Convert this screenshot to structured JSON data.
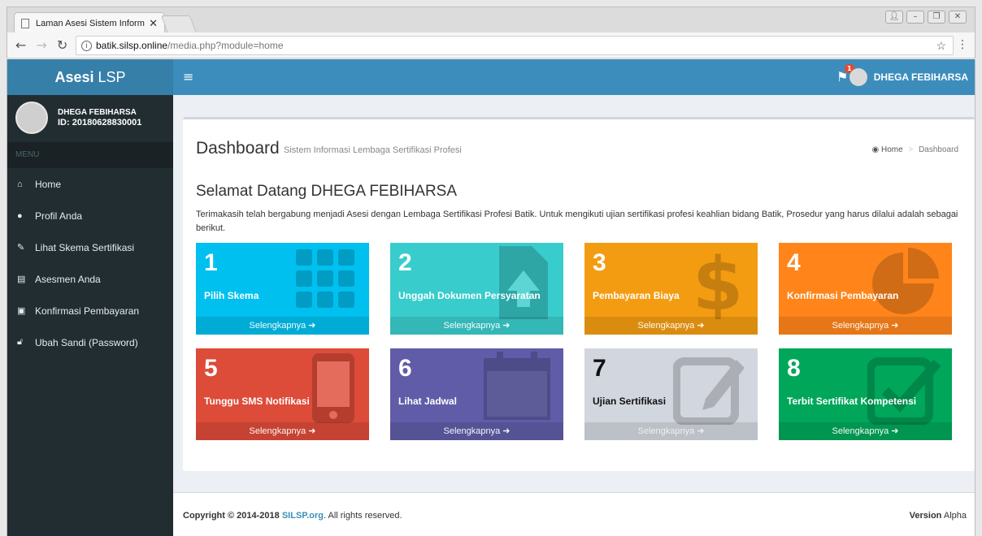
{
  "browser": {
    "tab_title": "Laman Asesi Sistem Inform",
    "url_host": "batik.silsp.online",
    "url_path": "/media.php?module=home"
  },
  "header": {
    "brand_bold": "Asesi",
    "brand_rest": " LSP",
    "notification_count": "1",
    "user_name": "DHEGA FEBIHARSA"
  },
  "sidebar": {
    "user_name": "DHEGA FEBIHARSA",
    "user_id": "ID: 20180628830001",
    "menu_header": "MENU",
    "items": [
      {
        "label": "Home",
        "icon": "home-icon"
      },
      {
        "label": "Profil Anda",
        "icon": "user-icon"
      },
      {
        "label": "Lihat Skema Sertifikasi",
        "icon": "edit-icon"
      },
      {
        "label": "Asesmen Anda",
        "icon": "file-icon"
      },
      {
        "label": "Konfirmasi Pembayaran",
        "icon": "money-icon"
      },
      {
        "label": "Ubah Sandi (Password)",
        "icon": "lock-icon"
      }
    ]
  },
  "main": {
    "title": "Dashboard",
    "subtitle": "Sistem Informasi Lembaga Sertifikasi Profesi",
    "breadcrumb_home": "Home",
    "breadcrumb_current": "Dashboard",
    "welcome": "Selamat Datang DHEGA FEBIHARSA",
    "intro": "Terimakasih telah bergabung menjadi Asesi dengan Lembaga Sertifikasi Profesi Batik. Untuk mengikuti ujian sertifikasi profesi keahlian bidang Batik, Prosedur yang harus dilalui adalah sebagai berikut.",
    "steps": [
      {
        "num": "1",
        "label": "Pilih Skema",
        "more": "Selengkapnya",
        "color": "#00c0ef",
        "icon": "th-icon"
      },
      {
        "num": "2",
        "label": "Unggah Dokumen Persyaratan",
        "more": "Selengkapnya",
        "color": "#39cccc",
        "icon": "upload-file-icon"
      },
      {
        "num": "3",
        "label": "Pembayaran Biaya",
        "more": "Selengkapnya",
        "color": "#f39c12",
        "icon": "dollar-icon"
      },
      {
        "num": "4",
        "label": "Konfirmasi Pembayaran",
        "more": "Selengkapnya",
        "color": "#ff851b",
        "icon": "pie-chart-icon"
      },
      {
        "num": "5",
        "label": "Tunggu SMS Notifikasi",
        "more": "Selengkapnya",
        "color": "#dd4b39",
        "icon": "mobile-icon"
      },
      {
        "num": "6",
        "label": "Lihat Jadwal",
        "more": "Selengkapnya",
        "color": "#605ca8",
        "icon": "calendar-icon"
      },
      {
        "num": "7",
        "label": "Ujian Sertifikasi",
        "more": "Selengkapnya",
        "color": "#d2d6de",
        "icon": "edit-square-icon"
      },
      {
        "num": "8",
        "label": "Terbit Sertifikat Kompetensi",
        "more": "Selengkapnya",
        "color": "#00a65a",
        "icon": "check-square-icon"
      }
    ]
  },
  "footer": {
    "copyright_prefix": "Copyright © 2014-2018 ",
    "site": "SILSP.org",
    "rights": ". All rights reserved.",
    "version_label": "Version",
    "version_value": "Alpha"
  }
}
